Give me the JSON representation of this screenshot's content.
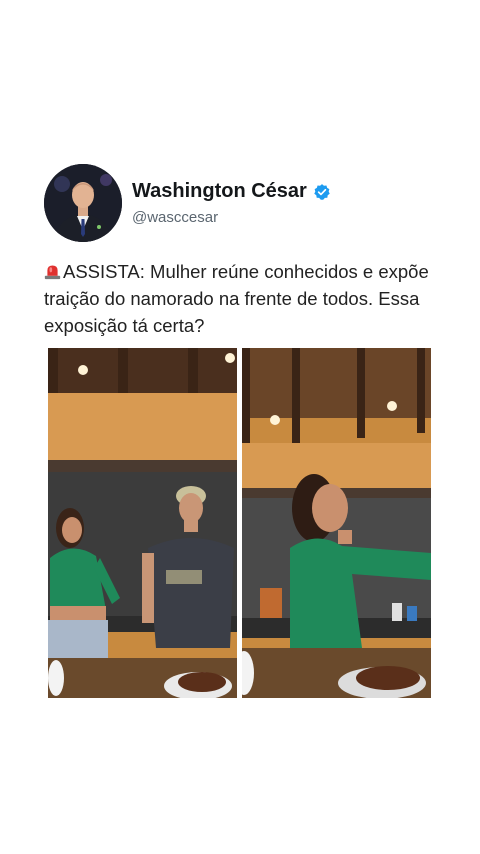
{
  "author": {
    "name": "Washington César",
    "handle": "@wasccesar",
    "avatar_icon": "profile-photo",
    "verified_icon": "verified-badge-icon",
    "verified_color": "#1d9bf0"
  },
  "tweet": {
    "siren_icon": "siren-emoji-icon",
    "text": "ASSISTA: Mulher reúne conhecidos e expõe traição do namorado na frente de todos. Essa exposição tá certa?"
  },
  "media": {
    "frames": [
      "video-frame-left",
      "video-frame-right"
    ]
  }
}
